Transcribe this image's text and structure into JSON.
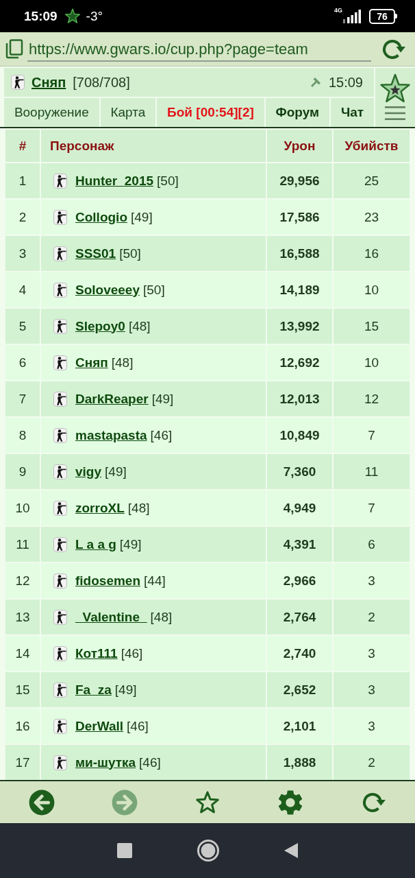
{
  "status_bar": {
    "time": "15:09",
    "temperature": "-3°",
    "network": "4G",
    "battery": "76"
  },
  "address_bar": {
    "url": "https://www.gwars.io/cup.php?page=team"
  },
  "header": {
    "player_name": "Сняп",
    "health": "[708/708]",
    "time": "15:09"
  },
  "tabs": [
    {
      "label": "Вооружение",
      "kind": "plain"
    },
    {
      "label": "Карта",
      "kind": "plain"
    },
    {
      "label": "Бой [00:54][2]",
      "kind": "alert"
    },
    {
      "label": "Форум",
      "kind": "bold"
    },
    {
      "label": "Чат",
      "kind": "bold"
    }
  ],
  "table": {
    "columns": [
      "#",
      "Персонаж",
      "Урон",
      "Убийств"
    ],
    "rows": [
      {
        "rank": "1",
        "name": "Hunter_2015",
        "level_label": "[50]",
        "damage": "29,956",
        "kills": "25"
      },
      {
        "rank": "2",
        "name": "Collogio",
        "level_label": "[49]",
        "damage": "17,586",
        "kills": "23"
      },
      {
        "rank": "3",
        "name": "SSS01",
        "level_label": "[50]",
        "damage": "16,588",
        "kills": "16"
      },
      {
        "rank": "4",
        "name": "Soloveeey",
        "level_label": "[50]",
        "damage": "14,189",
        "kills": "10"
      },
      {
        "rank": "5",
        "name": "Slepoy0",
        "level_label": "[48]",
        "damage": "13,992",
        "kills": "15"
      },
      {
        "rank": "6",
        "name": "Сняп",
        "level_label": "[48]",
        "damage": "12,692",
        "kills": "10"
      },
      {
        "rank": "7",
        "name": "DarkReaper",
        "level_label": "[49]",
        "damage": "12,013",
        "kills": "12"
      },
      {
        "rank": "8",
        "name": "mastapasta",
        "level_label": "[46]",
        "damage": "10,849",
        "kills": "7"
      },
      {
        "rank": "9",
        "name": "vigy",
        "level_label": "[49]",
        "damage": "7,360",
        "kills": "11"
      },
      {
        "rank": "10",
        "name": "zorroXL",
        "level_label": "[48]",
        "damage": "4,949",
        "kills": "7"
      },
      {
        "rank": "11",
        "name": "L a a g",
        "level_label": "[49]",
        "damage": "4,391",
        "kills": "6"
      },
      {
        "rank": "12",
        "name": "fidosemen",
        "level_label": "[44]",
        "damage": "2,966",
        "kills": "3"
      },
      {
        "rank": "13",
        "name": "_Valentine_",
        "level_label": "[48]",
        "damage": "2,764",
        "kills": "2"
      },
      {
        "rank": "14",
        "name": "Кот111",
        "level_label": "[46]",
        "damage": "2,740",
        "kills": "3"
      },
      {
        "rank": "15",
        "name": "Fa_za",
        "level_label": "[49]",
        "damage": "2,652",
        "kills": "3"
      },
      {
        "rank": "16",
        "name": "DerWall",
        "level_label": "[46]",
        "damage": "2,101",
        "kills": "3"
      },
      {
        "rank": "17",
        "name": "ми-шутка",
        "level_label": "[46]",
        "damage": "1,888",
        "kills": "2"
      }
    ]
  },
  "toolbar": {
    "buttons": [
      {
        "kind": "back",
        "disabled": false
      },
      {
        "kind": "forward",
        "disabled": true
      },
      {
        "kind": "bookmark",
        "disabled": false
      },
      {
        "kind": "settings",
        "disabled": false
      },
      {
        "kind": "reload",
        "disabled": false
      }
    ]
  }
}
